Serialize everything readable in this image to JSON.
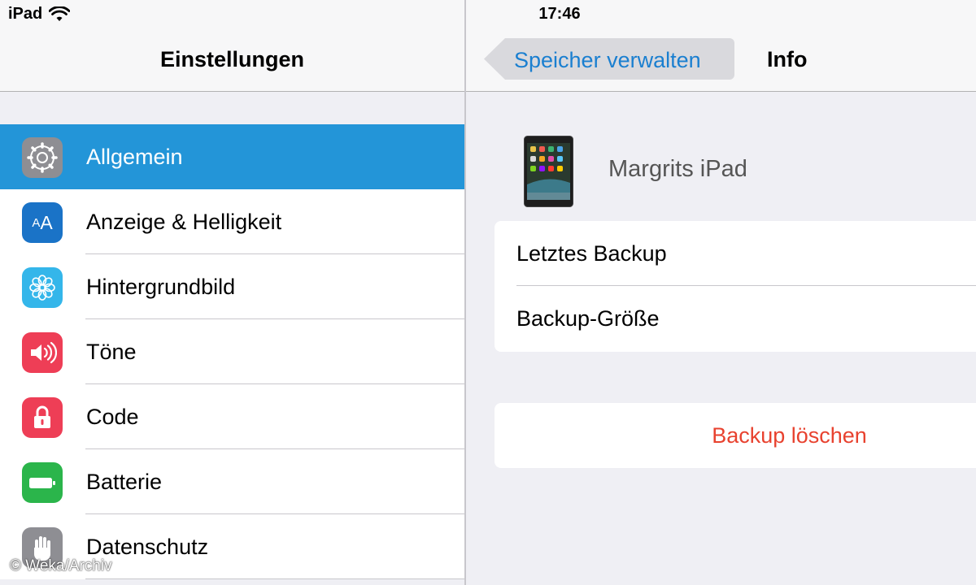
{
  "status_bar": {
    "device": "iPad",
    "wifi_icon": "wifi-icon",
    "time": "17:46"
  },
  "master": {
    "title": "Einstellungen",
    "items": [
      {
        "label": "Allgemein",
        "icon": "gear-icon",
        "color": "#8e8e93",
        "selected": true
      },
      {
        "label": "Anzeige & Helligkeit",
        "icon": "display-brightness-icon",
        "icon_text": "AA",
        "color": "#1a73c7",
        "selected": false
      },
      {
        "label": "Hintergrundbild",
        "icon": "wallpaper-flower-icon",
        "color": "#34b6ea",
        "selected": false
      },
      {
        "label": "Töne",
        "icon": "speaker-icon",
        "color": "#ee3e56",
        "selected": false
      },
      {
        "label": "Code",
        "icon": "lock-icon",
        "color": "#ee3e56",
        "selected": false
      },
      {
        "label": "Batterie",
        "icon": "battery-icon",
        "color": "#2bb54b",
        "selected": false
      },
      {
        "label": "Datenschutz",
        "icon": "hand-icon",
        "color": "#8e8e93",
        "selected": false
      }
    ],
    "selection_color": "#2395d8"
  },
  "detail": {
    "back_label": "Speicher verwalten",
    "title": "Info",
    "device_name": "Margrits iPad",
    "device_icon": "ipad-device-icon",
    "rows": [
      {
        "label": "Letztes Backup"
      },
      {
        "label": "Backup-Größe"
      }
    ],
    "delete_label": "Backup löschen",
    "accent_color": "#1a7fd0",
    "danger_color": "#e8422f"
  },
  "watermark": "© Weka/Archiv"
}
